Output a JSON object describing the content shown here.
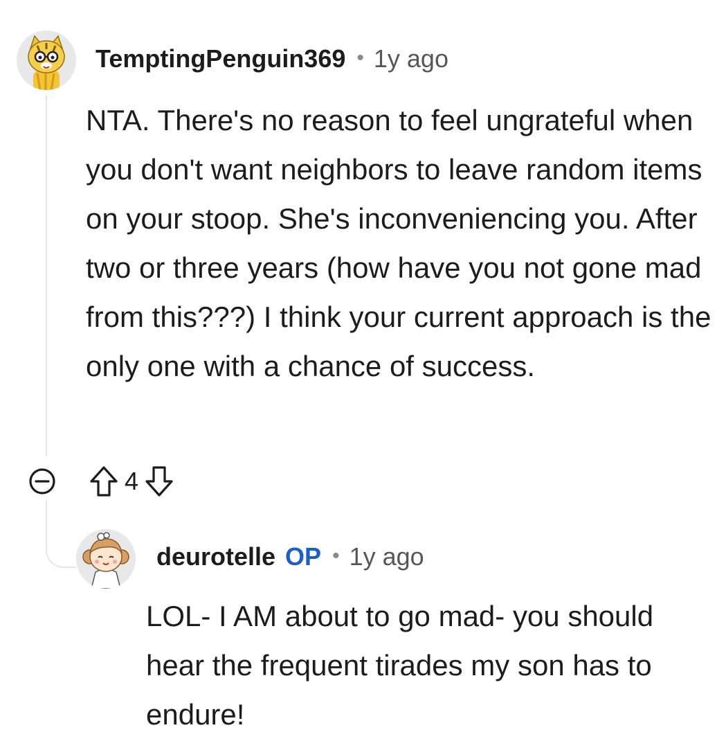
{
  "comments": [
    {
      "username": "TemptingPenguin369",
      "separator": "•",
      "age": "1y ago",
      "body": "NTA. There's no reason to feel ungrateful when you don't want neighbors to leave random items on your stoop. She's inconveniencing you. After two or three years (how have you not gone mad from this???) I think your current approach is the only one with a chance of success.",
      "votes": "4",
      "avatar_icon": "tiger-avatar-icon"
    },
    {
      "username": "deurotelle",
      "op_tag": "OP",
      "separator": "•",
      "age": "1y ago",
      "body": "LOL- I AM about to go mad- you should hear the frequent tirades my son has to endure!",
      "avatar_icon": "girl-avatar-icon"
    }
  ],
  "icons": {
    "collapse": "collapse-minus-icon",
    "upvote": "upvote-arrow-icon",
    "downvote": "downvote-arrow-icon"
  },
  "colors": {
    "op_tag": "#1a5fcc",
    "meta_gray": "#545759",
    "thread_line": "#e3e5e8"
  }
}
